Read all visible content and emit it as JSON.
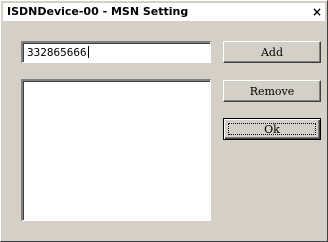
{
  "window": {
    "title": "ISDNDevice-00 - MSN Setting",
    "close_glyph": "×"
  },
  "msn_input": {
    "value": "332865666"
  },
  "buttons": {
    "add_label": "Add",
    "remove_label": "Remove",
    "ok_label": "Ok"
  },
  "msn_list": {
    "items": []
  },
  "colors": {
    "dialog_face": "#d4d0c8",
    "titlebar": "#ffffff",
    "field_background": "#ffffff"
  },
  "icons": {
    "close": "close-icon"
  }
}
